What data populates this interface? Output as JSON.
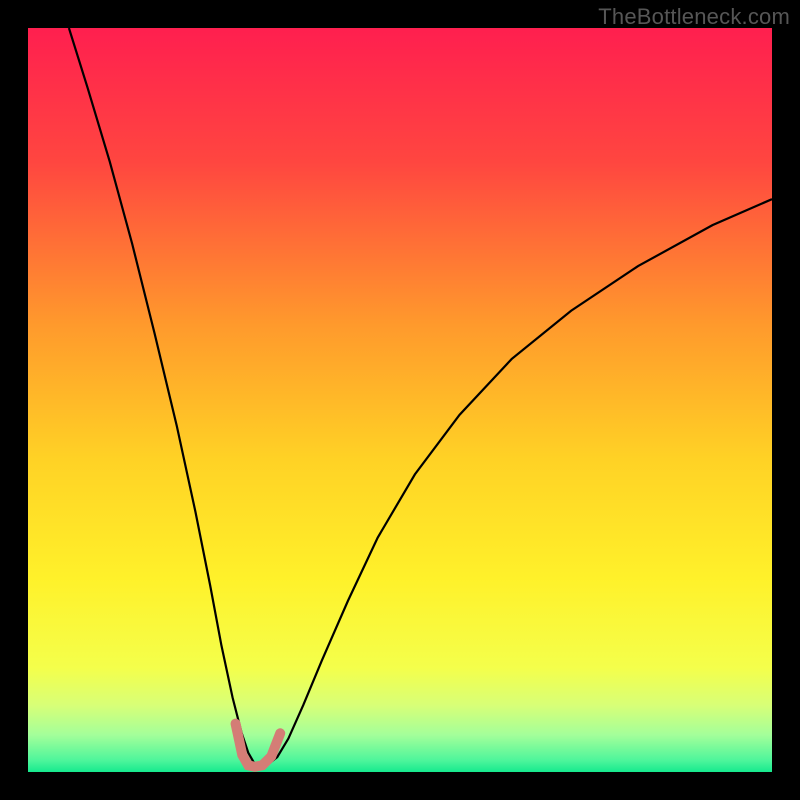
{
  "watermark": "TheBottleneck.com",
  "chart_data": {
    "type": "line",
    "title": "",
    "xlabel": "",
    "ylabel": "",
    "xlim": [
      0,
      100
    ],
    "ylim": [
      0,
      100
    ],
    "background_gradient": {
      "stops": [
        {
          "pos": 0.0,
          "color": "#ff1f4f"
        },
        {
          "pos": 0.18,
          "color": "#ff4640"
        },
        {
          "pos": 0.4,
          "color": "#ff9a2c"
        },
        {
          "pos": 0.58,
          "color": "#ffd225"
        },
        {
          "pos": 0.74,
          "color": "#fff12a"
        },
        {
          "pos": 0.86,
          "color": "#f4ff4b"
        },
        {
          "pos": 0.91,
          "color": "#d8ff77"
        },
        {
          "pos": 0.95,
          "color": "#a4ff9a"
        },
        {
          "pos": 0.985,
          "color": "#4cf59b"
        },
        {
          "pos": 1.0,
          "color": "#16e98e"
        }
      ]
    },
    "series": [
      {
        "name": "bottleneck-curve",
        "stroke": "#000000",
        "stroke_width": 2.2,
        "x": [
          5.5,
          8,
          11,
          14,
          17,
          20,
          22.5,
          24.5,
          26,
          27.5,
          28.7,
          29.6,
          30.4,
          31.2,
          32.2,
          33.5,
          35,
          37,
          39.5,
          43,
          47,
          52,
          58,
          65,
          73,
          82,
          92,
          100
        ],
        "y": [
          100,
          92,
          82,
          71,
          59,
          46.5,
          35,
          25,
          17,
          10,
          5.3,
          2.6,
          1.2,
          0.8,
          1.0,
          2.0,
          4.5,
          9,
          15,
          23,
          31.5,
          40,
          48,
          55.5,
          62,
          68,
          73.5,
          77
        ]
      },
      {
        "name": "marker-band",
        "stroke": "#d47d76",
        "stroke_width": 10,
        "linecap": "round",
        "x": [
          27.9,
          28.8,
          29.6,
          30.5,
          31.5,
          32.7,
          33.9
        ],
        "y": [
          6.5,
          2.3,
          0.9,
          0.7,
          0.9,
          2.1,
          5.2
        ]
      }
    ]
  }
}
